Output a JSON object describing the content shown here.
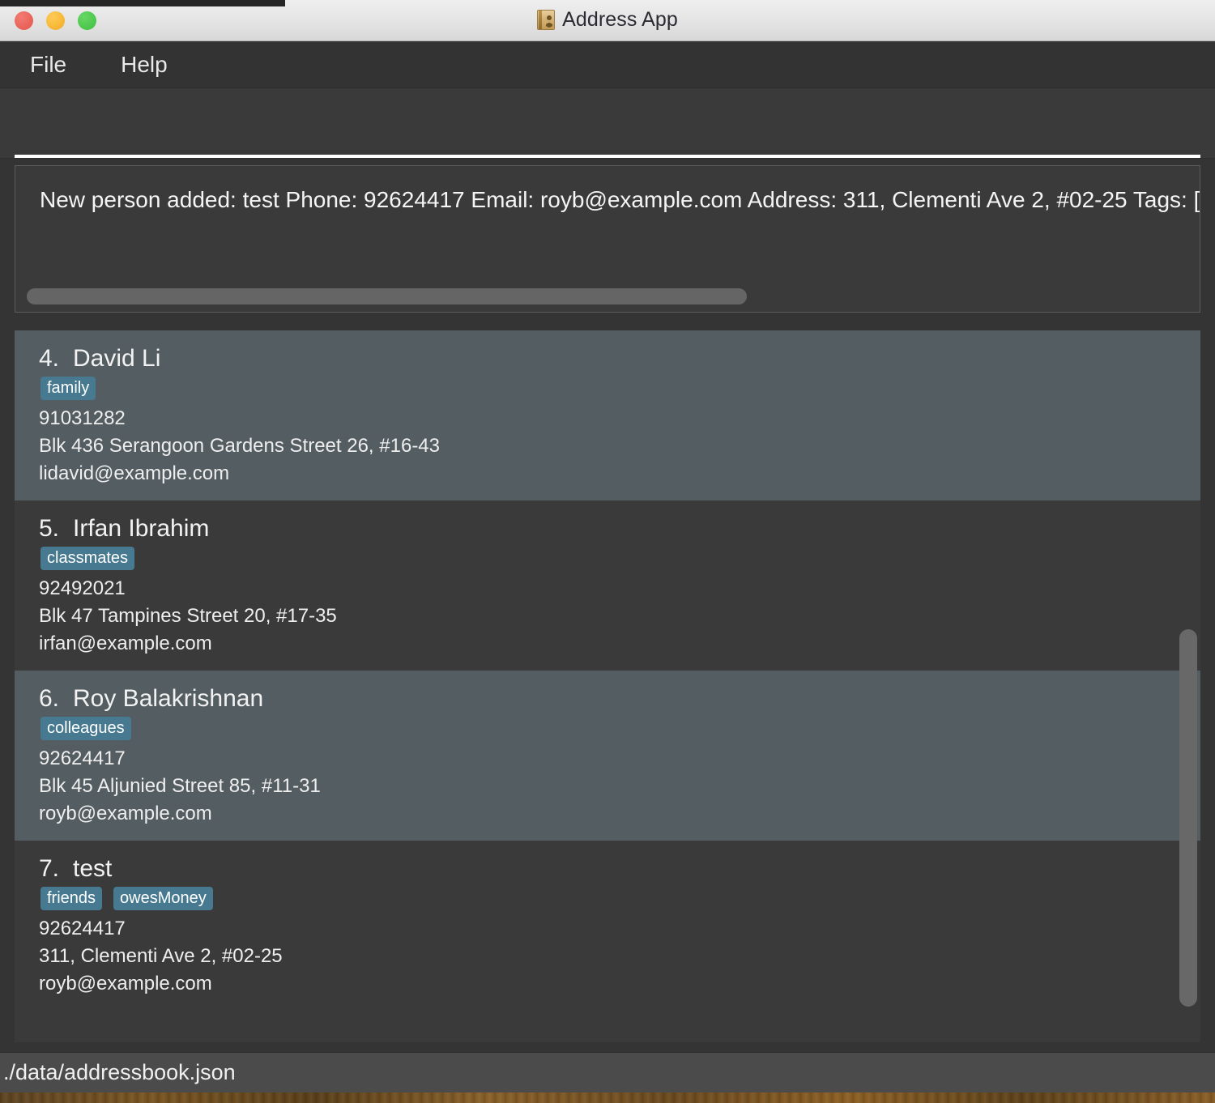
{
  "window": {
    "title": "Address App",
    "icon": "address-book-icon",
    "traffic_lights": [
      "close",
      "minimize",
      "zoom"
    ],
    "colors": {
      "close": "#e2564c",
      "minimize": "#f1ab25",
      "zoom": "#3dbf41",
      "tag_background": "#477a90",
      "selected_row": "#545d61",
      "base_row": "#3a3a3a",
      "chrome": "#333333",
      "statusbar": "#4b4b4b"
    }
  },
  "menubar": {
    "items": [
      {
        "label": "File"
      },
      {
        "label": "Help"
      }
    ]
  },
  "command": {
    "value": "",
    "placeholder": ""
  },
  "result": {
    "text": "New person added: test Phone: 92624417 Email: royb@example.com Address: 311, Clementi Ave 2, #02-25 Tags: [friends][owesMoney]",
    "scroll": {
      "horizontal_thumb_percent": 62,
      "vertical_thumb_percent": 53
    }
  },
  "list": {
    "persons": [
      {
        "index": "4.",
        "name": "David Li",
        "tags": [
          "family"
        ],
        "phone": "91031282",
        "address": "Blk 436 Serangoon Gardens Street 26, #16-43",
        "email": "lidavid@example.com",
        "highlighted": true
      },
      {
        "index": "5.",
        "name": "Irfan Ibrahim",
        "tags": [
          "classmates"
        ],
        "phone": "92492021",
        "address": "Blk 47 Tampines Street 20, #17-35",
        "email": "irfan@example.com",
        "highlighted": false
      },
      {
        "index": "6.",
        "name": "Roy Balakrishnan",
        "tags": [
          "colleagues"
        ],
        "phone": "92624417",
        "address": "Blk 45 Aljunied Street 85, #11-31",
        "email": "royb@example.com",
        "highlighted": true
      },
      {
        "index": "7.",
        "name": "test",
        "tags": [
          "friends",
          "owesMoney"
        ],
        "phone": "92624417",
        "address": "311, Clementi Ave 2, #02-25",
        "email": "royb@example.com",
        "highlighted": false
      }
    ]
  },
  "statusbar": {
    "path": "./data/addressbook.json"
  }
}
